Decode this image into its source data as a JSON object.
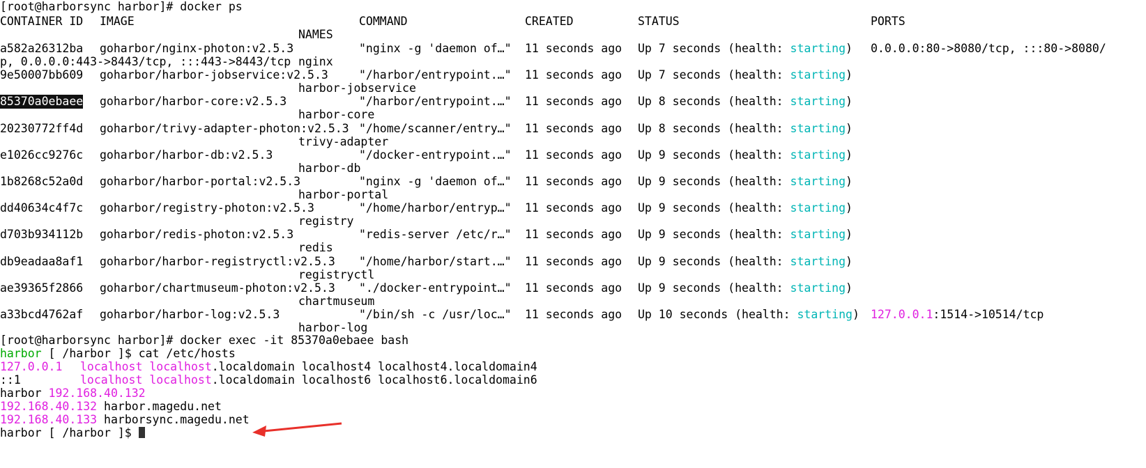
{
  "colors": {
    "cyan": "#00b5b5",
    "magenta": "#e020e0",
    "green": "#00aa00",
    "arrow": "#e8302a"
  },
  "cmd1": "[root@harborsync harbor]# docker ps",
  "headers": {
    "container_id": "CONTAINER ID",
    "image": "IMAGE",
    "command": "COMMAND",
    "created": "CREATED",
    "status": "STATUS",
    "ports": "PORTS",
    "names": "NAMES"
  },
  "containers": [
    {
      "id": "a582a26312ba",
      "image": "goharbor/nginx-photon:v2.5.3",
      "command": "\"nginx -g 'daemon of…\"",
      "created": "11 seconds ago",
      "status_pre": "Up 7 seconds (health: ",
      "status_word": "starting",
      "status_post": ")",
      "ports": "0.0.0.0:80->8080/tcp, :::80->8080/",
      "ports_cont": "p, 0.0.0.0:443->8443/tcp, :::443->8443/tcp",
      "name": "nginx"
    },
    {
      "id": "9e50007bb609",
      "image": "goharbor/harbor-jobservice:v2.5.3",
      "command": "\"/harbor/entrypoint.…\"",
      "created": "11 seconds ago",
      "status_pre": "Up 7 seconds (health: ",
      "status_word": "starting",
      "status_post": ")",
      "name": "harbor-jobservice"
    },
    {
      "id": "85370a0ebaee",
      "image": "goharbor/harbor-core:v2.5.3",
      "command": "\"/harbor/entrypoint.…\"",
      "created": "11 seconds ago",
      "status_pre": "Up 8 seconds (health: ",
      "status_word": "starting",
      "status_post": ")",
      "name": "harbor-core"
    },
    {
      "id": "20230772ff4d",
      "image": "goharbor/trivy-adapter-photon:v2.5.3",
      "command": "\"/home/scanner/entry…\"",
      "created": "11 seconds ago",
      "status_pre": "Up 8 seconds (health: ",
      "status_word": "starting",
      "status_post": ")",
      "name": "trivy-adapter"
    },
    {
      "id": "e1026cc9276c",
      "image": "goharbor/harbor-db:v2.5.3",
      "command": "\"/docker-entrypoint.…\"",
      "created": "11 seconds ago",
      "status_pre": "Up 9 seconds (health: ",
      "status_word": "starting",
      "status_post": ")",
      "name": "harbor-db"
    },
    {
      "id": "1b8268c52a0d",
      "image": "goharbor/harbor-portal:v2.5.3",
      "command": "\"nginx -g 'daemon of…\"",
      "created": "11 seconds ago",
      "status_pre": "Up 9 seconds (health: ",
      "status_word": "starting",
      "status_post": ")",
      "name": "harbor-portal"
    },
    {
      "id": "dd40634c4f7c",
      "image": "goharbor/registry-photon:v2.5.3",
      "command": "\"/home/harbor/entryp…\"",
      "created": "11 seconds ago",
      "status_pre": "Up 9 seconds (health: ",
      "status_word": "starting",
      "status_post": ")",
      "name": "registry"
    },
    {
      "id": "d703b934112b",
      "image": "goharbor/redis-photon:v2.5.3",
      "command": "\"redis-server /etc/r…\"",
      "created": "11 seconds ago",
      "status_pre": "Up 9 seconds (health: ",
      "status_word": "starting",
      "status_post": ")",
      "name": "redis"
    },
    {
      "id": "db9eadaa8af1",
      "image": "goharbor/harbor-registryctl:v2.5.3",
      "command": "\"/home/harbor/start.…\"",
      "created": "11 seconds ago",
      "status_pre": "Up 9 seconds (health: ",
      "status_word": "starting",
      "status_post": ")",
      "name": "registryctl"
    },
    {
      "id": "ae39365f2866",
      "image": "goharbor/chartmuseum-photon:v2.5.3",
      "command": "\"./docker-entrypoint…\"",
      "created": "11 seconds ago",
      "status_pre": "Up 9 seconds (health: ",
      "status_word": "starting",
      "status_post": ")",
      "name": "chartmuseum"
    },
    {
      "id": "a33bcd4762af",
      "image": "goharbor/harbor-log:v2.5.3",
      "command": "\"/bin/sh -c /usr/loc…\"",
      "created": "11 seconds ago",
      "status_pre": "Up 10 seconds (health: ",
      "status_word": "starting",
      "status_post": ")",
      "ports_ip": "127.0.0.1",
      "ports": ":1514->10514/tcp",
      "name": "harbor-log"
    }
  ],
  "cmd2": "[root@harborsync harbor]# docker exec -it 85370a0ebaee bash",
  "prompt": {
    "host": "harbor",
    "path": " [ /harbor ]$ ",
    "cmd": "cat /etc/hosts"
  },
  "hosts": [
    {
      "ip": "127.0.0.1",
      "h1": "localhost",
      "h2": "localhost",
      "rest": ".localdomain localhost4 localhost4.localdomain4"
    },
    {
      "ip": "::1",
      "h1": "localhost",
      "h2": "localhost",
      "rest": ".localdomain localhost6 localhost6.localdomain6"
    }
  ],
  "harbor_line": {
    "name": "harbor",
    "ip": "192.168.40.132"
  },
  "extra_hosts": [
    {
      "ip": "192.168.40.132",
      "name": "harbor.magedu.net"
    },
    {
      "ip": "192.168.40.133",
      "name": "harborsync.magedu.net"
    }
  ],
  "last_prompt": "harbor [ /harbor ]$ "
}
